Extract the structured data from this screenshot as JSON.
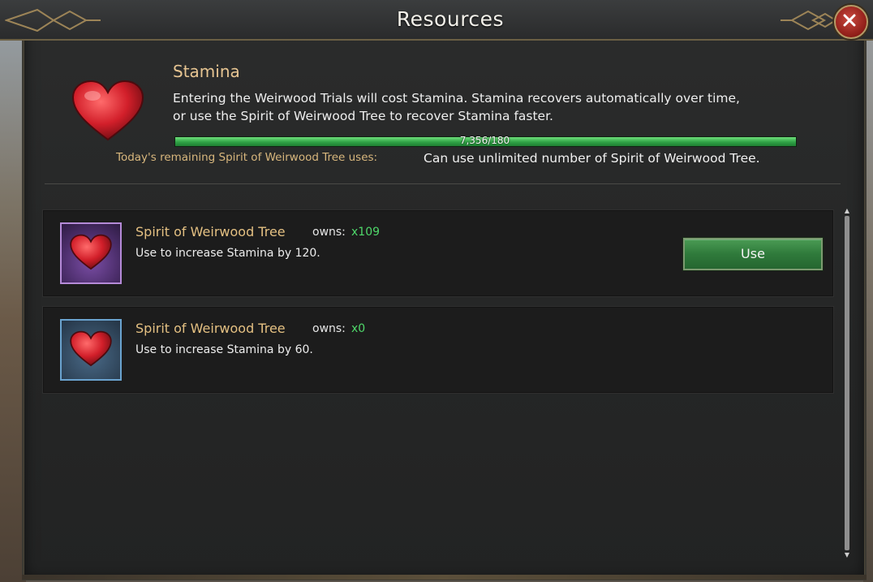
{
  "window": {
    "title": "Resources",
    "close_icon": "close-icon"
  },
  "stamina": {
    "title": "Stamina",
    "description": "Entering the Weirwood Trials will cost Stamina. Stamina recovers automatically over time,\n or use the Spirit of Weirwood Tree to recover Stamina faster.",
    "progress_text": "7,356/180",
    "progress_fraction": 1.0,
    "uses_label": "Today's remaining Spirit of Weirwood Tree uses:",
    "uses_value": "Can use unlimited number of Spirit of Weirwood Tree.",
    "icon": "heart-icon"
  },
  "items": [
    {
      "name": "Spirit of Weirwood Tree",
      "owns_label": "owns:",
      "owns_value": "x109",
      "description": "Use to increase Stamina by 120.",
      "rarity_color": "#b58ad8",
      "action_label": "Use",
      "icon": "heart-icon"
    },
    {
      "name": "Spirit of Weirwood Tree",
      "owns_label": "owns:",
      "owns_value": "x0",
      "description": "Use to increase Stamina by 60.",
      "rarity_color": "#6aa3cf",
      "icon": "heart-icon"
    }
  ],
  "colors": {
    "accent_gold": "#e4c082",
    "owns_green": "#4fd86a",
    "progress_green": "#2fa145",
    "button_green": "#2f7a3b",
    "close_red": "#8e1d17"
  }
}
